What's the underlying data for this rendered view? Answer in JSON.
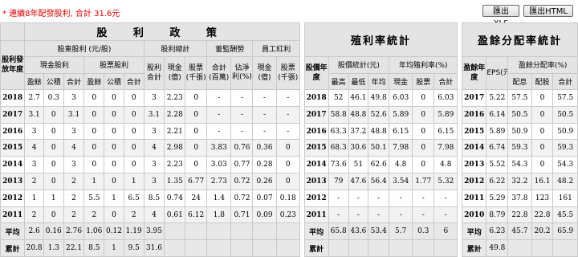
{
  "note": "* 連續8年配發股利, 合計 31.6元",
  "buttons": {
    "xls": "匯出XLS",
    "html": "匯出HTML"
  },
  "headers": {
    "dividend_policy": "股 利 政 策",
    "yield_stats": "殖利率統計",
    "payout_stats": "盈餘分配率統計",
    "year_col": "股利發放年度",
    "cash_stock_div": "股東股利 (元/股)",
    "total_div": "股利總計",
    "director_fee": "董監酬勞",
    "employee_bonus": "員工紅利",
    "cash_div": "現金股利",
    "stock_div": "股票股利",
    "div_total_col": "股利合計",
    "cash_yi": "現金(億)",
    "stock_k": "股票(千張)",
    "total_baiwan": "合計(百萬)",
    "eps_ratio": "佔淨利(%)",
    "emp_cash_yi": "現金(億)",
    "emp_stock_k": "股票(千張)",
    "yield_year": "股價年度",
    "price_stats": "股價統計(元)",
    "avg_yield": "年均殖利率(%)",
    "payout_year": "盈餘年度",
    "eps": "EPS(元)",
    "payout_ratio": "盈餘分配率(%)",
    "surplus": "盈餘",
    "reserve": "公積",
    "total": "合計",
    "high": "最高",
    "low": "最低",
    "avg": "年均",
    "cash": "現金",
    "stock": "股票",
    "allot": "配息",
    "stock_allot": "配股"
  },
  "rows": [
    {
      "y": "2018",
      "c": [
        "2.7",
        "0.3",
        "3",
        "0",
        "0",
        "0",
        "3",
        "2.23",
        "0",
        "-",
        "-",
        "-",
        "-"
      ],
      "py": "2018",
      "p": [
        "52",
        "46.1",
        "49.8",
        "6.03",
        "0",
        "6.03"
      ],
      "ey": "2017",
      "e": [
        "5.22",
        "57.5",
        "0",
        "57.5"
      ]
    },
    {
      "y": "2017",
      "c": [
        "3.1",
        "0",
        "3.1",
        "0",
        "0",
        "0",
        "3.1",
        "2.28",
        "0",
        "-",
        "-",
        "-",
        "-"
      ],
      "py": "2017",
      "p": [
        "58.8",
        "48.8",
        "52.6",
        "5.89",
        "0",
        "5.89"
      ],
      "ey": "2016",
      "e": [
        "6.14",
        "50.5",
        "0",
        "50.5"
      ]
    },
    {
      "y": "2016",
      "c": [
        "3",
        "0",
        "3",
        "0",
        "0",
        "0",
        "3",
        "2.21",
        "0",
        "-",
        "-",
        "-",
        "-"
      ],
      "py": "2016",
      "p": [
        "63.3",
        "37.2",
        "48.8",
        "6.15",
        "0",
        "6.15"
      ],
      "ey": "2015",
      "e": [
        "5.89",
        "50.9",
        "0",
        "50.9"
      ]
    },
    {
      "y": "2015",
      "c": [
        "4",
        "0",
        "4",
        "0",
        "0",
        "0",
        "4",
        "2.98",
        "0",
        "3.83",
        "0.76",
        "0.36",
        "0"
      ],
      "py": "2015",
      "p": [
        "68.3",
        "30.6",
        "50.1",
        "7.98",
        "0",
        "7.98"
      ],
      "ey": "2014",
      "e": [
        "6.74",
        "59.3",
        "0",
        "59.3"
      ]
    },
    {
      "y": "2014",
      "c": [
        "3",
        "0",
        "3",
        "0",
        "0",
        "0",
        "3",
        "2.23",
        "0",
        "3.03",
        "0.77",
        "0.28",
        "0"
      ],
      "py": "2014",
      "p": [
        "73.6",
        "51",
        "62.6",
        "4.8",
        "0",
        "4.8"
      ],
      "ey": "2013",
      "e": [
        "5.52",
        "54.3",
        "0",
        "54.3"
      ]
    },
    {
      "y": "2013",
      "c": [
        "2",
        "0",
        "2",
        "1",
        "0",
        "1",
        "3",
        "1.35",
        "6.77",
        "2.73",
        "0.72",
        "0.26",
        "0"
      ],
      "py": "2013",
      "p": [
        "79",
        "47.6",
        "56.4",
        "3.54",
        "1.77",
        "5.32"
      ],
      "ey": "2012",
      "e": [
        "6.22",
        "32.2",
        "16.1",
        "48.2"
      ]
    },
    {
      "y": "2012",
      "c": [
        "1",
        "1",
        "2",
        "5.5",
        "1",
        "6.5",
        "8.5",
        "0.74",
        "24",
        "1.4",
        "0.72",
        "0.07",
        "0.18"
      ],
      "py": "2012",
      "p": [
        "-",
        "-",
        "-",
        "-",
        "-",
        "-"
      ],
      "ey": "2011",
      "e": [
        "5.29",
        "37.8",
        "123",
        "161"
      ]
    },
    {
      "y": "2011",
      "c": [
        "2",
        "0",
        "2",
        "2",
        "0",
        "2",
        "4",
        "0.61",
        "6.12",
        "1.8",
        "0.71",
        "0.09",
        "0.23"
      ],
      "py": "2011",
      "p": [
        "-",
        "-",
        "-",
        "-",
        "-",
        "-"
      ],
      "ey": "2010",
      "e": [
        "8.79",
        "22.8",
        "22.8",
        "45.5"
      ]
    }
  ],
  "avg_row": {
    "label": "平均",
    "c": [
      "2.6",
      "0.16",
      "2.76",
      "1.06",
      "0.12",
      "1.19",
      "3.95",
      "",
      "",
      "",
      "",
      "",
      ""
    ],
    "plabel": "平均",
    "p": [
      "65.8",
      "43.6",
      "53.4",
      "5.7",
      "0.3",
      "6"
    ],
    "elabel": "平均",
    "e": [
      "6.23",
      "45.7",
      "20.2",
      "65.9"
    ]
  },
  "sum_row": {
    "label": "累計",
    "c": [
      "20.8",
      "1.3",
      "22.1",
      "8.5",
      "1",
      "9.5",
      "31.6",
      "",
      "",
      "",
      "",
      "",
      ""
    ],
    "plabel": "累計",
    "p": [
      "",
      "",
      "",
      "",
      "",
      ""
    ],
    "elabel": "累計",
    "e": [
      "49.8",
      "",
      "",
      ""
    ]
  }
}
